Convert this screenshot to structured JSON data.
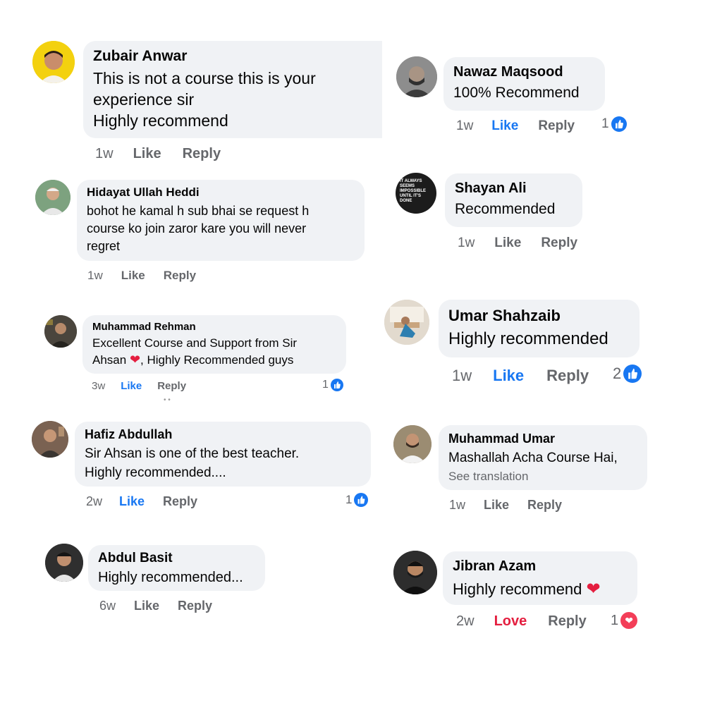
{
  "colors": {
    "bubble": "#f0f2f5",
    "like_blue": "#1877f2",
    "love_red": "#e41e3f",
    "meta_gray": "#65676b"
  },
  "comments": [
    {
      "author": "Zubair Anwar",
      "lines": [
        "This is not a course this is your",
        "experience sir",
        "Highly recommend"
      ],
      "time": "1w",
      "like": "Like",
      "reply": "Reply",
      "liked": false
    },
    {
      "author": "Hidayat Ullah Heddi",
      "lines": [
        "bohot he kamal h sub bhai se request h",
        "course ko join zaror kare you will never",
        "regret"
      ],
      "time": "1w",
      "like": "Like",
      "reply": "Reply",
      "liked": false
    },
    {
      "author": "Muhammad Rehman",
      "lines": [
        "Excellent Course and Support from Sir",
        "Ahsan",
        ", Highly Recommended guys"
      ],
      "time": "3w",
      "like": "Like",
      "reply": "Reply",
      "liked": true,
      "reaction_count": "1",
      "reaction": "like",
      "emoji": "heart-icon"
    },
    {
      "author": "Hafiz Abdullah",
      "lines": [
        "Sir Ahsan is one of the best teacher.",
        "Highly recommended...."
      ],
      "time": "2w",
      "like": "Like",
      "reply": "Reply",
      "liked": true,
      "reaction_count": "1",
      "reaction": "like"
    },
    {
      "author": "Abdul Basit",
      "lines": [
        "Highly recommended..."
      ],
      "time": "6w",
      "like": "Like",
      "reply": "Reply",
      "liked": false
    },
    {
      "author": "Nawaz Maqsood",
      "lines": [
        "100% Recommend"
      ],
      "time": "1w",
      "like": "Like",
      "reply": "Reply",
      "liked": true,
      "reaction_count": "1",
      "reaction": "like"
    },
    {
      "author": "Shayan Ali",
      "lines": [
        "Recommended"
      ],
      "time": "1w",
      "like": "Like",
      "reply": "Reply",
      "liked": false,
      "avatar_text": [
        "IT ALWAYS",
        "SEEMS",
        "IMPOSSIBLE",
        "UNTIL IT'S",
        "DONE"
      ]
    },
    {
      "author": "Umar Shahzaib",
      "lines": [
        "Highly recommended"
      ],
      "time": "1w",
      "like": "Like",
      "reply": "Reply",
      "liked": true,
      "reaction_count": "2",
      "reaction": "like"
    },
    {
      "author": "Muhammad Umar",
      "lines": [
        "Mashallah Acha Course Hai,"
      ],
      "see_translation": "See translation",
      "time": "1w",
      "like": "Like",
      "reply": "Reply",
      "liked": false
    },
    {
      "author": "Jibran Azam",
      "lines": [
        "Highly recommend"
      ],
      "time": "2w",
      "like": "Love",
      "reply": "Reply",
      "liked": "love",
      "reaction_count": "1",
      "reaction": "love",
      "emoji": "heart-icon"
    }
  ]
}
